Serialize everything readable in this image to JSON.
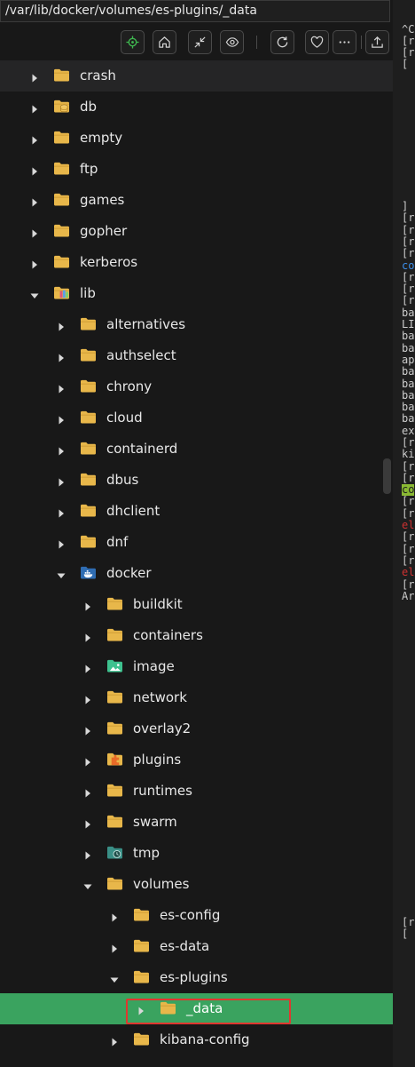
{
  "path_bar": {
    "text": "/var/lib/docker/volumes/es-plugins/_data"
  },
  "toolbar": {
    "buttons": [
      {
        "name": "locate-button",
        "icon": "locate-icon"
      },
      {
        "name": "home-button",
        "icon": "home-icon"
      },
      {
        "name": "collapse-button",
        "icon": "collapse-icon"
      },
      {
        "name": "view-button",
        "icon": "eye-icon"
      },
      {
        "name": "refresh-button",
        "icon": "refresh-icon"
      },
      {
        "name": "favorite-button",
        "icon": "heart-icon"
      },
      {
        "name": "more-button",
        "icon": "more-icon"
      },
      {
        "name": "upload-button",
        "icon": "upload-icon"
      }
    ]
  },
  "colors": {
    "folder": "#e8b74a",
    "selected_row": "#3aa35f",
    "highlight_box": "#e0372f",
    "toolbar_accent": "#3fb950"
  },
  "tree": [
    {
      "label": "crash",
      "depth": 0,
      "expanded": false,
      "icon": "folder-icon"
    },
    {
      "label": "db",
      "depth": 0,
      "expanded": false,
      "icon": "database-folder-icon"
    },
    {
      "label": "empty",
      "depth": 0,
      "expanded": false,
      "icon": "folder-icon"
    },
    {
      "label": "ftp",
      "depth": 0,
      "expanded": false,
      "icon": "folder-icon"
    },
    {
      "label": "games",
      "depth": 0,
      "expanded": false,
      "icon": "folder-icon"
    },
    {
      "label": "gopher",
      "depth": 0,
      "expanded": false,
      "icon": "folder-icon"
    },
    {
      "label": "kerberos",
      "depth": 0,
      "expanded": false,
      "icon": "folder-icon"
    },
    {
      "label": "lib",
      "depth": 0,
      "expanded": true,
      "icon": "lib-folder-icon"
    },
    {
      "label": "alternatives",
      "depth": 1,
      "expanded": false,
      "icon": "folder-icon"
    },
    {
      "label": "authselect",
      "depth": 1,
      "expanded": false,
      "icon": "folder-icon"
    },
    {
      "label": "chrony",
      "depth": 1,
      "expanded": false,
      "icon": "folder-icon"
    },
    {
      "label": "cloud",
      "depth": 1,
      "expanded": false,
      "icon": "folder-icon"
    },
    {
      "label": "containerd",
      "depth": 1,
      "expanded": false,
      "icon": "folder-icon"
    },
    {
      "label": "dbus",
      "depth": 1,
      "expanded": false,
      "icon": "folder-icon"
    },
    {
      "label": "dhclient",
      "depth": 1,
      "expanded": false,
      "icon": "folder-icon"
    },
    {
      "label": "dnf",
      "depth": 1,
      "expanded": false,
      "icon": "folder-icon"
    },
    {
      "label": "docker",
      "depth": 1,
      "expanded": true,
      "icon": "docker-folder-icon"
    },
    {
      "label": "buildkit",
      "depth": 2,
      "expanded": false,
      "icon": "folder-icon"
    },
    {
      "label": "containers",
      "depth": 2,
      "expanded": false,
      "icon": "folder-icon"
    },
    {
      "label": "image",
      "depth": 2,
      "expanded": false,
      "icon": "image-folder-icon"
    },
    {
      "label": "network",
      "depth": 2,
      "expanded": false,
      "icon": "folder-icon"
    },
    {
      "label": "overlay2",
      "depth": 2,
      "expanded": false,
      "icon": "folder-icon"
    },
    {
      "label": "plugins",
      "depth": 2,
      "expanded": false,
      "icon": "plugins-folder-icon"
    },
    {
      "label": "runtimes",
      "depth": 2,
      "expanded": false,
      "icon": "folder-icon"
    },
    {
      "label": "swarm",
      "depth": 2,
      "expanded": false,
      "icon": "folder-icon"
    },
    {
      "label": "tmp",
      "depth": 2,
      "expanded": false,
      "icon": "tmp-folder-icon"
    },
    {
      "label": "volumes",
      "depth": 2,
      "expanded": true,
      "icon": "folder-icon"
    },
    {
      "label": "es-config",
      "depth": 3,
      "expanded": false,
      "icon": "folder-icon"
    },
    {
      "label": "es-data",
      "depth": 3,
      "expanded": false,
      "icon": "folder-icon"
    },
    {
      "label": "es-plugins",
      "depth": 3,
      "expanded": true,
      "icon": "folder-icon"
    },
    {
      "label": "_data",
      "depth": 4,
      "expanded": false,
      "icon": "folder-icon",
      "selected": true
    },
    {
      "label": "kibana-config",
      "depth": 3,
      "expanded": false,
      "icon": "folder-icon"
    }
  ],
  "terminal": {
    "lines": [
      {
        "text": "",
        "color": "#cccccc"
      },
      {
        "text": "",
        "color": "#cccccc"
      },
      {
        "text": "^C",
        "color": "#cccccc"
      },
      {
        "text": "[r",
        "color": "#cccccc"
      },
      {
        "text": "[r",
        "color": "#cccccc"
      },
      {
        "text": "[",
        "color": "#cccccc"
      },
      {
        "text": "",
        "color": "#cccccc"
      },
      {
        "text": "",
        "color": "#cccccc"
      },
      {
        "text": "",
        "color": "#cccccc"
      },
      {
        "text": "",
        "color": "#cccccc"
      },
      {
        "text": "",
        "color": "#cccccc"
      },
      {
        "text": "",
        "color": "#cccccc"
      },
      {
        "text": "",
        "color": "#cccccc"
      },
      {
        "text": "",
        "color": "#cccccc"
      },
      {
        "text": "",
        "color": "#cccccc"
      },
      {
        "text": "",
        "color": "#cccccc"
      },
      {
        "text": "",
        "color": "#cccccc"
      },
      {
        "text": "]",
        "color": "#cccccc"
      },
      {
        "text": "[r",
        "color": "#cccccc"
      },
      {
        "text": "[r",
        "color": "#cccccc"
      },
      {
        "text": "[r",
        "color": "#cccccc"
      },
      {
        "text": "[r",
        "color": "#cccccc"
      },
      {
        "text": "co",
        "color": "#3b8eea"
      },
      {
        "text": "[r",
        "color": "#cccccc"
      },
      {
        "text": "[r",
        "color": "#cccccc"
      },
      {
        "text": "[r",
        "color": "#cccccc"
      },
      {
        "text": "ba",
        "color": "#cccccc"
      },
      {
        "text": "LI",
        "color": "#cccccc"
      },
      {
        "text": "ba",
        "color": "#cccccc"
      },
      {
        "text": "ba",
        "color": "#cccccc"
      },
      {
        "text": "ap",
        "color": "#cccccc"
      },
      {
        "text": "ba",
        "color": "#cccccc"
      },
      {
        "text": "ba",
        "color": "#cccccc"
      },
      {
        "text": "ba",
        "color": "#cccccc"
      },
      {
        "text": "ba",
        "color": "#cccccc"
      },
      {
        "text": "ba",
        "color": "#cccccc"
      },
      {
        "text": "ex",
        "color": "#cccccc"
      },
      {
        "text": "[r",
        "color": "#cccccc"
      },
      {
        "text": "ki",
        "color": "#cccccc"
      },
      {
        "text": "[r",
        "color": "#cccccc"
      },
      {
        "text": "[r",
        "color": "#cccccc"
      },
      {
        "text": "co",
        "color": "#1e1e1e",
        "bg": "#8ab933"
      },
      {
        "text": "[r",
        "color": "#cccccc"
      },
      {
        "text": "[r",
        "color": "#cccccc"
      },
      {
        "text": "el",
        "color": "#cd3131"
      },
      {
        "text": "[r",
        "color": "#cccccc"
      },
      {
        "text": "[r",
        "color": "#cccccc"
      },
      {
        "text": "[r",
        "color": "#cccccc"
      },
      {
        "text": "el",
        "color": "#cd3131"
      },
      {
        "text": "[r",
        "color": "#cccccc"
      },
      {
        "text": "Ar",
        "color": "#cccccc"
      }
    ],
    "bottom_lines": [
      {
        "text": "[r",
        "color": "#cccccc"
      },
      {
        "text": "[",
        "color": "#cccccc"
      }
    ]
  }
}
